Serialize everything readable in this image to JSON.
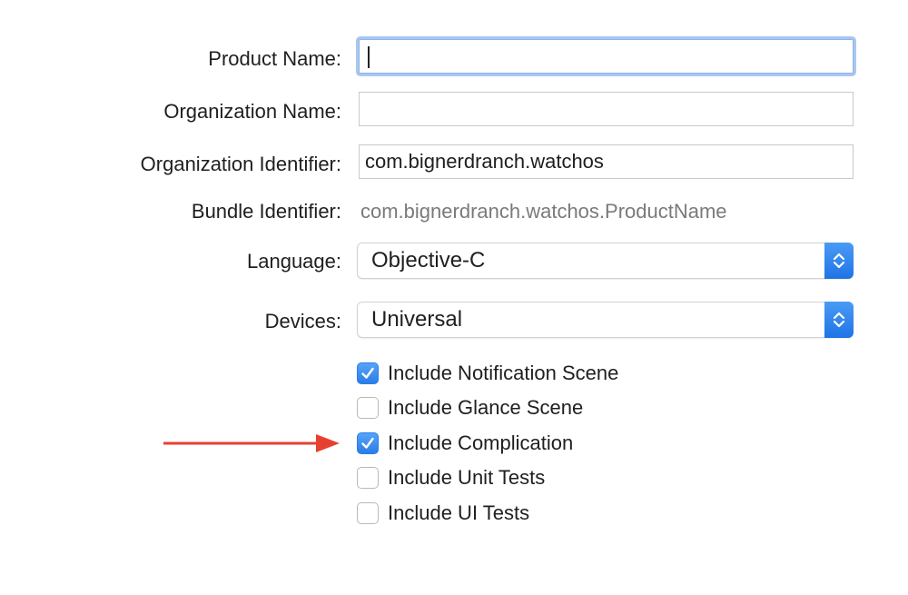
{
  "form": {
    "product_name": {
      "label": "Product Name:",
      "value": ""
    },
    "organization_name": {
      "label": "Organization Name:",
      "value": ""
    },
    "organization_identifier": {
      "label": "Organization Identifier:",
      "value": "com.bignerdranch.watchos"
    },
    "bundle_identifier": {
      "label": "Bundle Identifier:",
      "value": "com.bignerdranch.watchos.ProductName"
    },
    "language": {
      "label": "Language:",
      "value": "Objective-C"
    },
    "devices": {
      "label": "Devices:",
      "value": "Universal"
    }
  },
  "options": [
    {
      "label": "Include Notification Scene",
      "checked": true
    },
    {
      "label": "Include Glance Scene",
      "checked": false
    },
    {
      "label": "Include Complication",
      "checked": true
    },
    {
      "label": "Include Unit Tests",
      "checked": false
    },
    {
      "label": "Include UI Tests",
      "checked": false
    }
  ],
  "colors": {
    "accent": "#2a7de9",
    "focus_ring": "#a9c7f3",
    "annotation_arrow": "#e8402f"
  },
  "annotation": {
    "icon": "red-arrow-icon",
    "points_to": "Include Complication"
  }
}
